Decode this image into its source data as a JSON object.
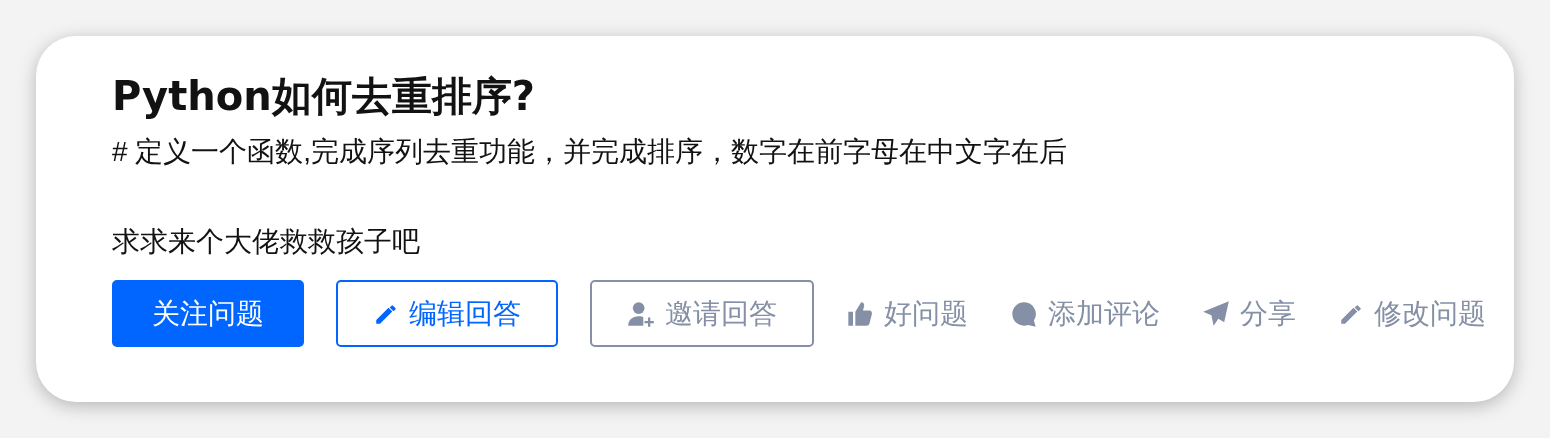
{
  "question": {
    "title": "Python如何去重排序?",
    "body": [
      "# 定义一个函数,完成序列去重功能，并完成排序，数字在前字母在中文字在后",
      "求求来个大佬救救孩子吧"
    ]
  },
  "buttons": [
    {
      "label": "关注问题",
      "kind": "primary"
    },
    {
      "label": "编辑回答",
      "kind": "outline"
    },
    {
      "label": "邀请回答",
      "kind": "muted"
    }
  ],
  "actions": [
    "好问题",
    "添加评论",
    "分享",
    "修改问题"
  ]
}
